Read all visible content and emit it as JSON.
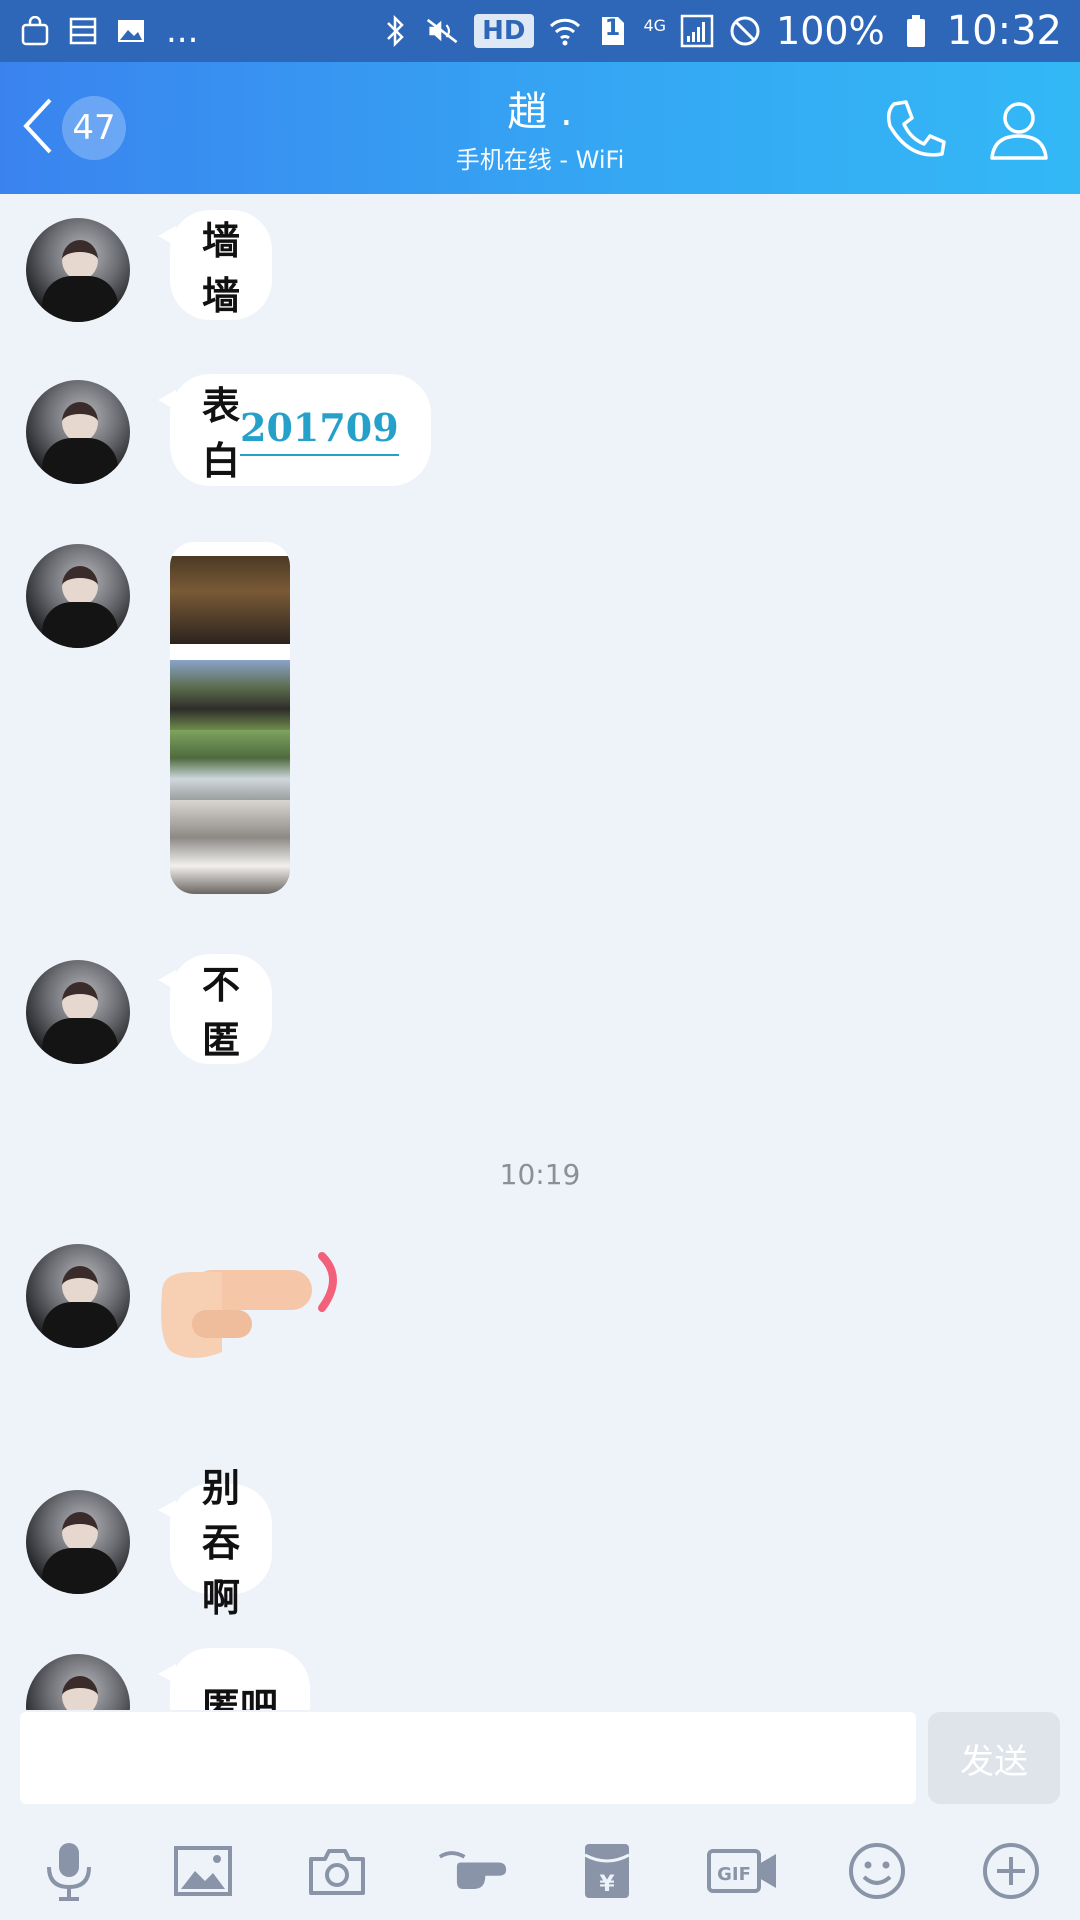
{
  "status_bar": {
    "ellipsis": "...",
    "hd": "HD",
    "sim": "1",
    "network": "4G",
    "battery": "100%",
    "time": "10:32"
  },
  "header": {
    "unread_count": "47",
    "title": "趙 .",
    "subtitle": "手机在线 - WiFi"
  },
  "messages": [
    {
      "type": "text",
      "text": "墙墙"
    },
    {
      "type": "text",
      "text": "表白",
      "link": "201709"
    },
    {
      "type": "image"
    },
    {
      "type": "text",
      "text": "不匿"
    },
    {
      "type": "text",
      "text": "别吞啊"
    },
    {
      "type": "text",
      "text": "匿吧"
    }
  ],
  "timestamp": "10:19",
  "input": {
    "value": "",
    "placeholder": ""
  },
  "send_label": "发送",
  "toolbar_icons": [
    "microphone-icon",
    "image-icon",
    "camera-icon",
    "poke-icon",
    "red-packet-icon",
    "gif-icon",
    "emoji-icon",
    "plus-icon"
  ],
  "colors": {
    "header_start": "#3a83ef",
    "header_end": "#33b8f6",
    "link": "#25a1c9",
    "background": "#eef2f9"
  }
}
